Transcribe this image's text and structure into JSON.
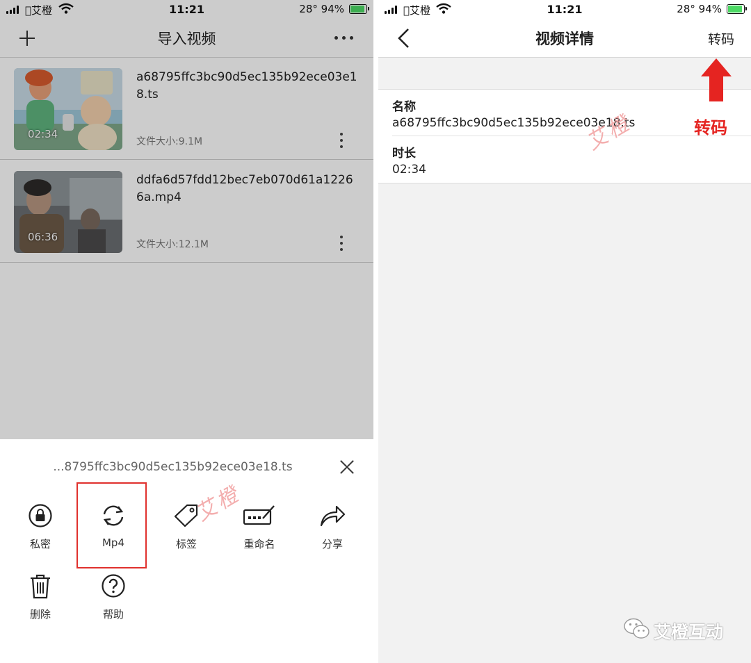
{
  "status_bar": {
    "carrier": "艾橙",
    "time": "11:21",
    "temperature": "28°",
    "battery": "94%"
  },
  "left_screen": {
    "title": "导入视频",
    "videos": [
      {
        "name": "a68795ffc3bc90d5ec135b92ece03e18.ts",
        "duration": "02:34",
        "size": "文件大小:9.1M"
      },
      {
        "name": "ddfa6d57fdd12bec7eb070d61a12266a.mp4",
        "duration": "06:36",
        "size": "文件大小:12.1M"
      }
    ],
    "sheet": {
      "title": "...8795ffc3bc90d5ec135b92ece03e18.ts",
      "actions": [
        {
          "label": "私密",
          "icon": "lock-icon"
        },
        {
          "label": "Mp4",
          "icon": "refresh-icon"
        },
        {
          "label": "标签",
          "icon": "tag-icon"
        },
        {
          "label": "重命名",
          "icon": "rename-icon"
        },
        {
          "label": "分享",
          "icon": "share-icon"
        },
        {
          "label": "删除",
          "icon": "trash-icon"
        },
        {
          "label": "帮助",
          "icon": "help-icon"
        }
      ]
    }
  },
  "right_screen": {
    "title": "视频详情",
    "action_label": "转码",
    "fields": [
      {
        "key": "名称",
        "value": "a68795ffc3bc90d5ec135b92ece03e18.ts"
      },
      {
        "key": "时长",
        "value": "02:34"
      }
    ],
    "annotation": "转码"
  },
  "watermark": "艾橙",
  "brand": "艾橙互动",
  "colors": {
    "highlight": "#e0312d",
    "annotation": "#e52421",
    "battery": "#4cd964"
  }
}
